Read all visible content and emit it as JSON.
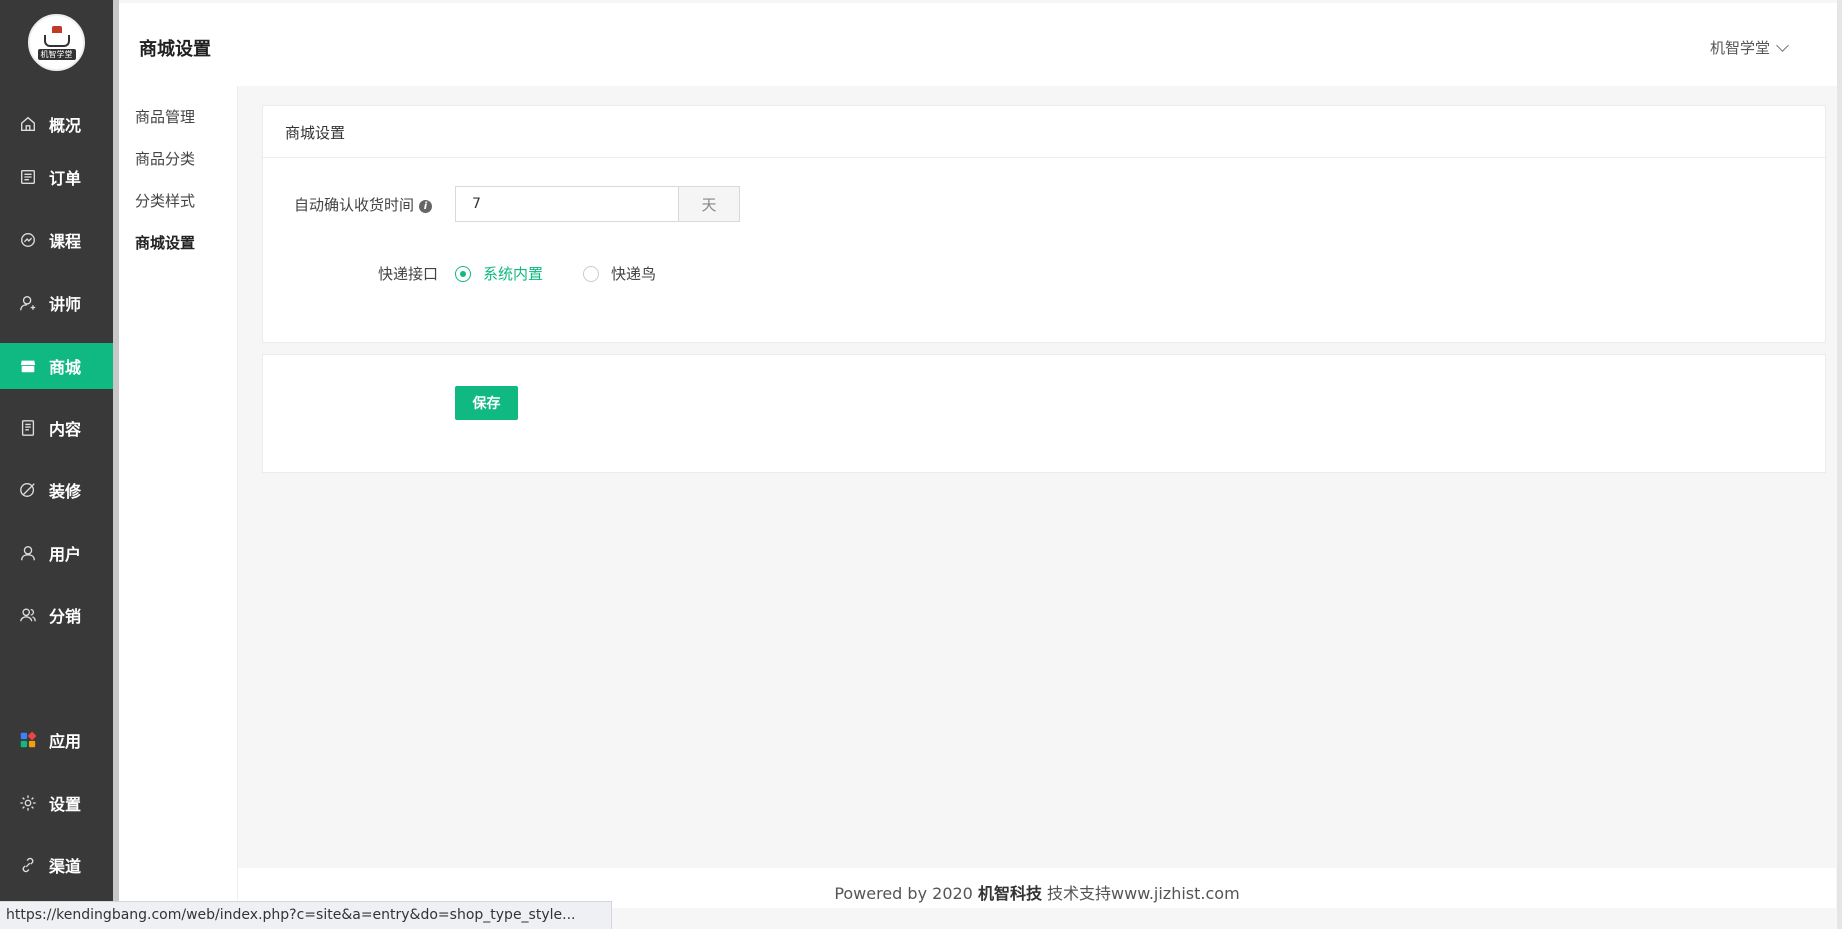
{
  "header": {
    "title": "商城设置",
    "user": "机智学堂"
  },
  "logo": {
    "text": "机智学堂"
  },
  "sidebar": {
    "items": [
      {
        "label": "概况",
        "icon": "home-icon"
      },
      {
        "label": "订单",
        "icon": "order-icon"
      },
      {
        "label": "课程",
        "icon": "course-icon"
      },
      {
        "label": "讲师",
        "icon": "teacher-icon"
      },
      {
        "label": "商城",
        "icon": "store-icon",
        "active": true
      },
      {
        "label": "内容",
        "icon": "content-icon"
      },
      {
        "label": "装修",
        "icon": "decorate-icon"
      },
      {
        "label": "用户",
        "icon": "user-icon"
      },
      {
        "label": "分销",
        "icon": "distribution-icon"
      },
      {
        "label": "应用",
        "icon": "apps-icon"
      },
      {
        "label": "设置",
        "icon": "gear-icon"
      },
      {
        "label": "渠道",
        "icon": "link-icon"
      }
    ]
  },
  "subnav": {
    "items": [
      {
        "label": "商品管理"
      },
      {
        "label": "商品分类"
      },
      {
        "label": "分类样式"
      },
      {
        "label": "商城设置",
        "current": true
      }
    ]
  },
  "panel": {
    "title": "商城设置",
    "auto_confirm_label": "自动确认收货时间",
    "auto_confirm_value": "7",
    "auto_confirm_unit": "天",
    "express_label": "快递接口",
    "express_options": [
      {
        "label": "系统内置",
        "checked": true
      },
      {
        "label": "快递鸟",
        "checked": false
      }
    ]
  },
  "actions": {
    "save_label": "保存"
  },
  "footer": {
    "prefix": "Powered by 2020 ",
    "brand": "机智科技",
    "suffix": " 技术支持www.jizhist.com"
  },
  "status_url": "https://kendingbang.com/web/index.php?c=site&a=entry&do=shop_type_style...",
  "colors": {
    "accent": "#10b981",
    "sidebar": "#393939"
  }
}
